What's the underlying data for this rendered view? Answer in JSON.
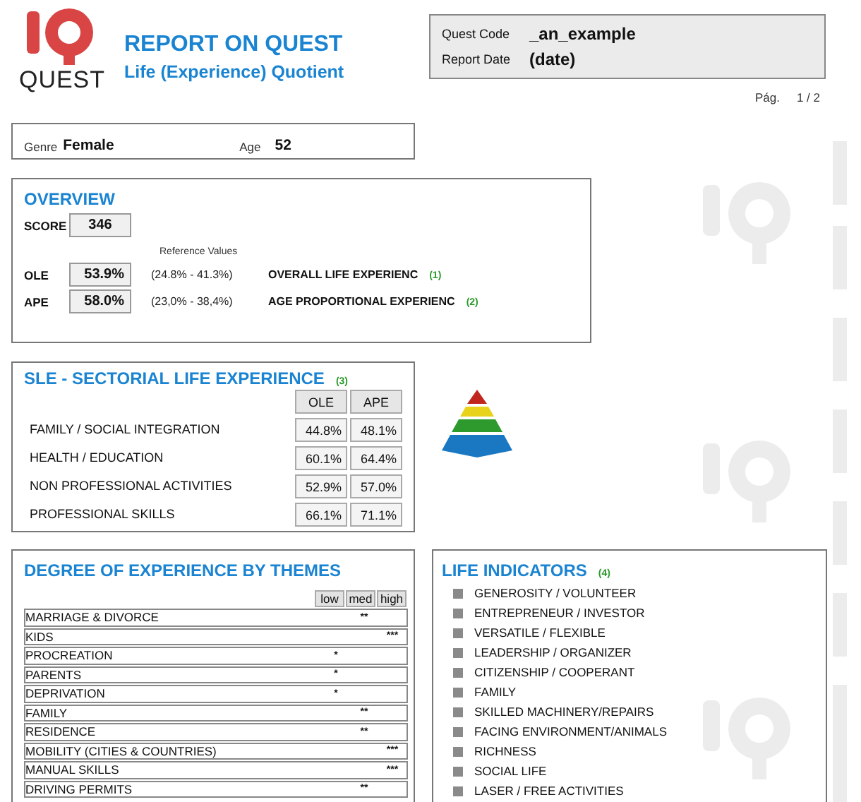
{
  "header": {
    "logo_text": "QUEST",
    "title": "REPORT ON QUEST",
    "subtitle": "Life (Experience) Quotient",
    "fields": [
      {
        "label": "Quest Code",
        "value": "_an_example"
      },
      {
        "label": "Report Date",
        "value": "(date)"
      }
    ],
    "page_label": "Pág.",
    "page_value": "1 / 2"
  },
  "person": {
    "genre_label": "Genre",
    "genre": "Female",
    "age_label": "Age",
    "age": "52"
  },
  "overview": {
    "title": "OVERVIEW",
    "score_label": "SCORE",
    "score": "346",
    "reference_heading": "Reference Values",
    "rows": [
      {
        "label": "OLE",
        "value": "53.9%",
        "reference": "(24.8% - 41.3%)",
        "description": "OVERALL LIFE EXPERIENC",
        "note": "(1)"
      },
      {
        "label": "APE",
        "value": "58.0%",
        "reference": "(23,0% - 38,4%)",
        "description": "AGE PROPORTIONAL EXPERIENC",
        "note": "(2)"
      }
    ]
  },
  "sle": {
    "title": "SLE - SECTORIAL LIFE EXPERIENCE",
    "note": "(3)",
    "columns": [
      "OLE",
      "APE"
    ],
    "rows": [
      {
        "label": "FAMILY / SOCIAL INTEGRATION",
        "values": [
          "44.8%",
          "48.1%"
        ]
      },
      {
        "label": "HEALTH / EDUCATION",
        "values": [
          "60.1%",
          "64.4%"
        ]
      },
      {
        "label": "NON PROFESSIONAL ACTIVITIES",
        "values": [
          "52.9%",
          "57.0%"
        ]
      },
      {
        "label": "PROFESSIONAL SKILLS",
        "values": [
          "66.1%",
          "71.1%"
        ]
      }
    ]
  },
  "themes": {
    "title": "DEGREE OF EXPERIENCE BY THEMES",
    "columns": [
      "low",
      "med",
      "high"
    ],
    "rows": [
      {
        "label": "MARRIAGE & DIVORCE",
        "mark": "**",
        "kind": "med"
      },
      {
        "label": "KIDS",
        "mark": "***",
        "kind": "high"
      },
      {
        "label": "PROCREATION",
        "mark": "*",
        "kind": "low"
      },
      {
        "label": "PARENTS",
        "mark": "*",
        "kind": "low"
      },
      {
        "label": "DEPRIVATION",
        "mark": "*",
        "kind": "low"
      },
      {
        "label": "FAMILY",
        "mark": "**",
        "kind": "med"
      },
      {
        "label": "RESIDENCE",
        "mark": "**",
        "kind": "med"
      },
      {
        "label": "MOBILITY (CITIES & COUNTRIES)",
        "mark": "***",
        "kind": "high"
      },
      {
        "label": "MANUAL SKILLS",
        "mark": "***",
        "kind": "high"
      },
      {
        "label": "DRIVING PERMITS",
        "mark": "**",
        "kind": "med"
      }
    ]
  },
  "indicators": {
    "title": "LIFE INDICATORS",
    "note": "(4)",
    "items": [
      "GENEROSITY / VOLUNTEER",
      "ENTREPRENEUR / INVESTOR",
      "VERSATILE / FLEXIBLE",
      "LEADERSHIP / ORGANIZER",
      "CITIZENSHIP / COOPERANT",
      "FAMILY",
      "SKILLED MACHINERY/REPAIRS",
      "FACING ENVIRONMENT/ANIMALS",
      "RICHNESS",
      "SOCIAL LIFE",
      "LASER / FREE ACTIVITIES"
    ]
  }
}
